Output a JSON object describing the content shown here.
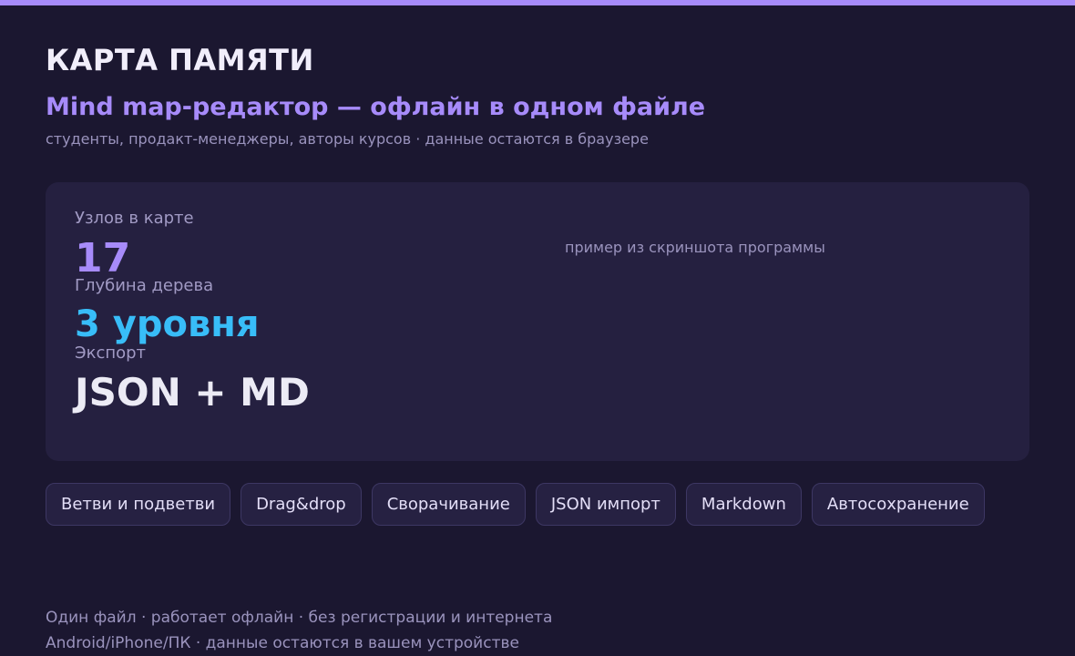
{
  "accent_color": "#a78bfa",
  "header": {
    "title": "КАРТА ПАМЯТИ",
    "subtitle": "Mind map-редактор — офлайн в одном файле",
    "audience": "студенты, продакт-менеджеры, авторы курсов · данные остаются в браузере"
  },
  "stats": [
    {
      "label": "Узлов в карте",
      "value": "17",
      "color": "#a78bfa"
    },
    {
      "label": "Глубина дерева",
      "value": "3 уровня",
      "color": "#38bdf8"
    },
    {
      "label": "Экспорт",
      "value": "JSON + MD",
      "color": "#ecebf5"
    }
  ],
  "screenshot_caption": "пример из скриншота программы",
  "features": [
    "Ветви и подветви",
    "Drag&drop",
    "Сворачивание",
    "JSON импорт",
    "Markdown",
    "Автосохранение"
  ],
  "footer": {
    "line1": "Один файл · работает офлайн · без регистрации и интернета",
    "line2": "Android/iPhone/ПК · данные остаются в вашем устройстве"
  }
}
